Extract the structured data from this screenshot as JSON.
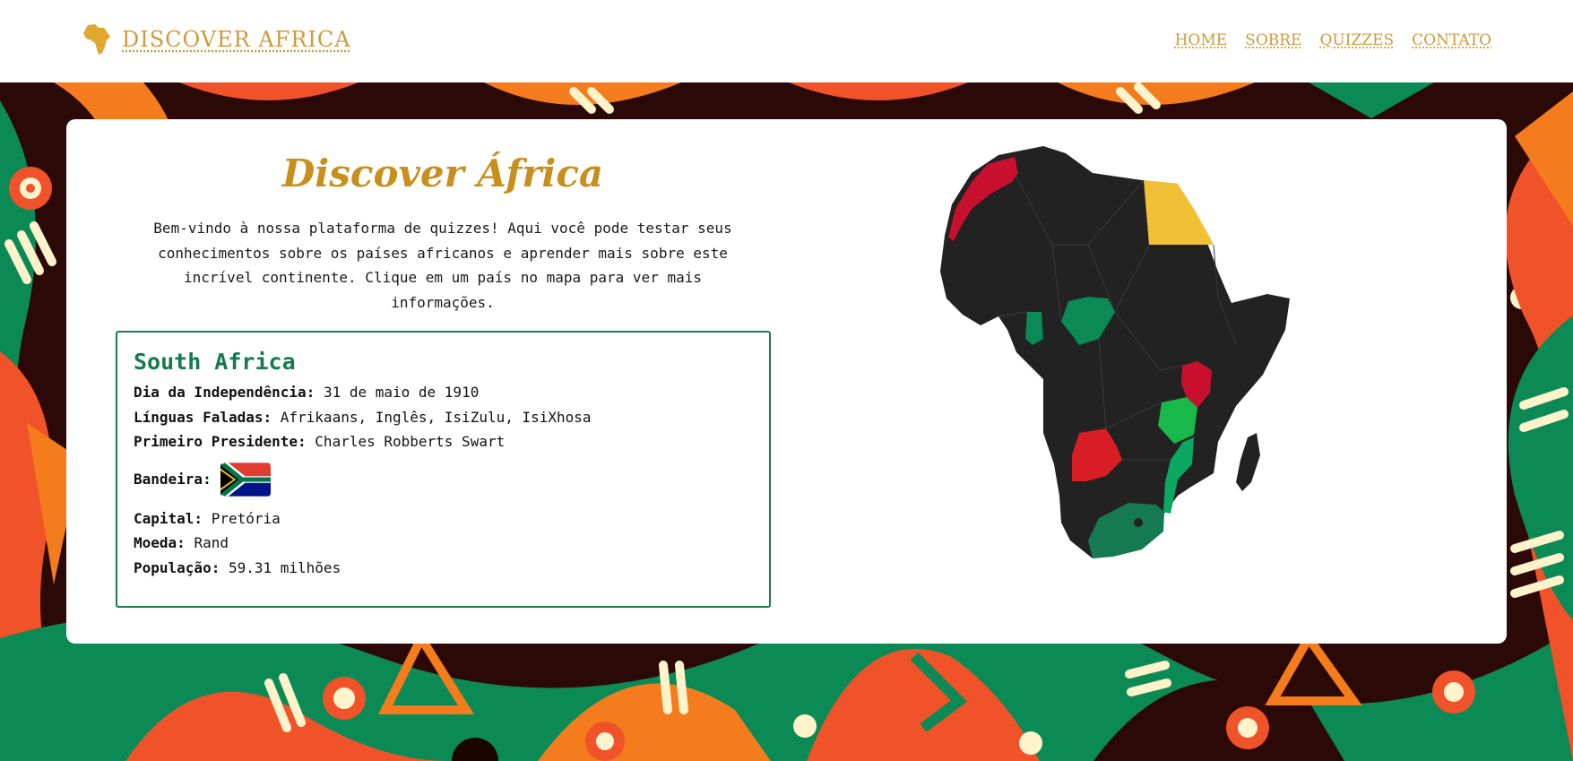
{
  "header": {
    "logo_text": "DISCOVER AFRICA",
    "nav": [
      {
        "label": "HOME"
      },
      {
        "label": "SOBRE"
      },
      {
        "label": "QUIZZES"
      },
      {
        "label": "CONTATO"
      }
    ]
  },
  "main": {
    "title": "Discover África",
    "intro": "Bem-vindo à nossa plataforma de quizzes! Aqui você pode testar seus conhecimentos sobre os países africanos e aprender mais sobre este incrível continente. Clique em um país no mapa para ver mais informações.",
    "country": {
      "name": "South Africa",
      "independence_label": "Dia da Independência:",
      "independence_value": "31 de maio de 1910",
      "languages_label": "Línguas Faladas:",
      "languages_value": "Afrikaans, Inglês, IsiZulu, IsiXhosa",
      "president_label": "Primeiro Presidente:",
      "president_value": "Charles Robberts Swart",
      "flag_label": "Bandeira:",
      "capital_label": "Capital:",
      "capital_value": "Pretória",
      "currency_label": "Moeda:",
      "currency_value": "Rand",
      "population_label": "População:",
      "population_value": "59.31 milhões"
    }
  },
  "colors": {
    "accent_gold": "#cf9a3c",
    "title_gold": "#c88f1d",
    "info_green": "#157a52",
    "map_base": "#222222",
    "map_red": "#c8102e",
    "map_yellow": "#f2c037",
    "map_green": "#0b8a55",
    "map_lightgreen": "#19b84a"
  }
}
